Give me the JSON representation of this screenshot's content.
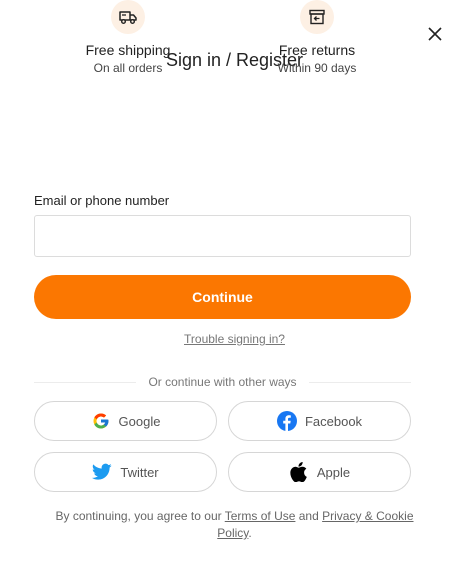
{
  "dialog": {
    "title": "Sign in / Register",
    "close_icon": "close-icon"
  },
  "benefits": [
    {
      "icon": "truck-icon",
      "title": "Free shipping",
      "subtitle": "On all orders"
    },
    {
      "icon": "return-box-icon",
      "title": "Free returns",
      "subtitle": "Within 90 days"
    }
  ],
  "form": {
    "email_label": "Email or phone number",
    "email_value": "",
    "email_placeholder": "",
    "continue_label": "Continue",
    "trouble_link": "Trouble signing in?"
  },
  "divider_text": "Or continue with other ways",
  "social": {
    "google": "Google",
    "facebook": "Facebook",
    "twitter": "Twitter",
    "apple": "Apple"
  },
  "terms": {
    "prefix": "By continuing, you agree to our ",
    "terms_link": "Terms of Use",
    "middle": " and ",
    "privacy_link": "Privacy & Cookie Policy",
    "suffix": "."
  },
  "colors": {
    "accent": "#fb7701",
    "icon_bg": "#fdf0e4",
    "facebook": "#1877f2",
    "twitter": "#1d9bf0"
  }
}
